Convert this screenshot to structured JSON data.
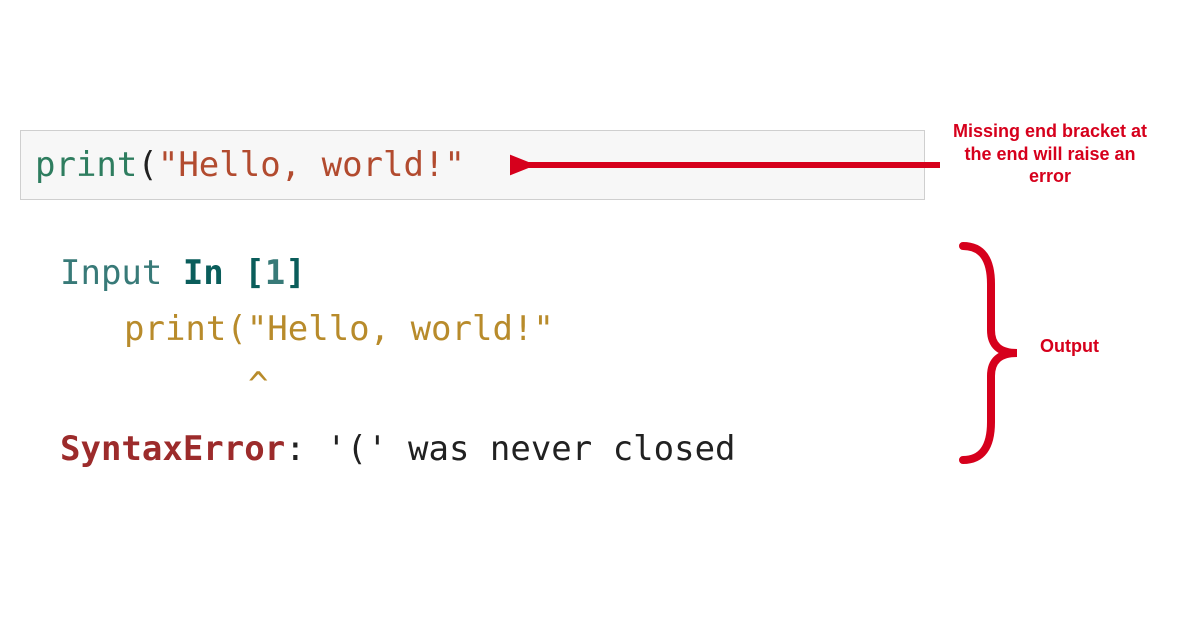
{
  "code_input": {
    "func": "print",
    "open_paren": "(",
    "string": "\"Hello, world!\""
  },
  "output": {
    "input_label": "Input ",
    "in_label": "In ",
    "bracket_open": "[",
    "num": "1",
    "bracket_close": "]",
    "echo_line": "print(\"Hello, world!\"",
    "caret": "^",
    "error_name": "SyntaxError",
    "colon": ": ",
    "error_msg": "'(' was never closed"
  },
  "annotations": {
    "missing_bracket": "Missing end bracket at the end will raise an error",
    "output_label": "Output"
  },
  "colors": {
    "annotation_red": "#d6001c"
  }
}
